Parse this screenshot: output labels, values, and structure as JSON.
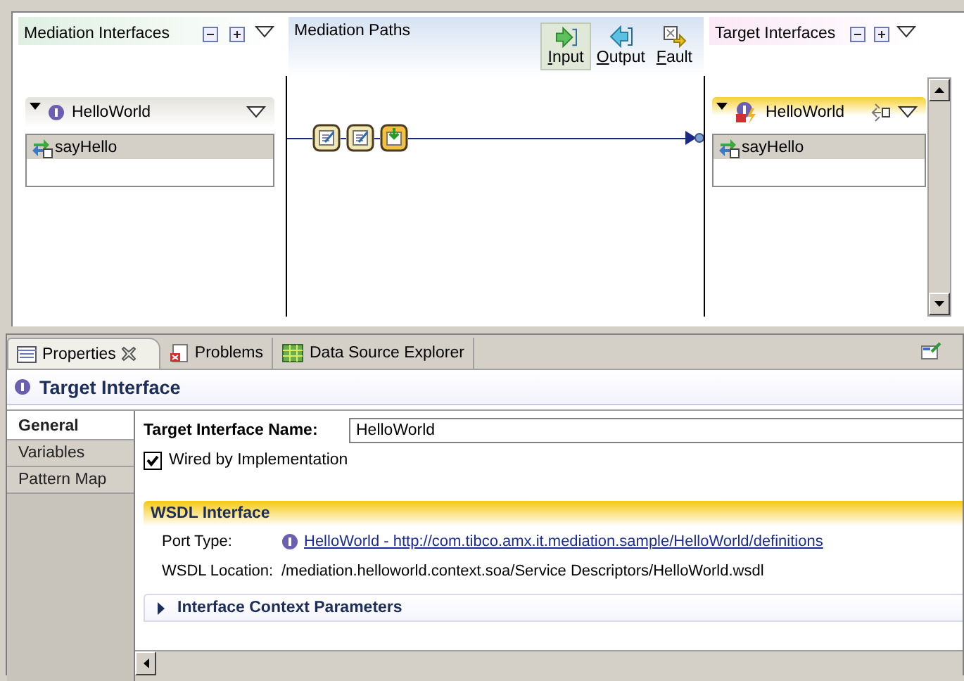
{
  "editor": {
    "mediation_interfaces": {
      "title": "Mediation Interfaces",
      "interface": {
        "name": "HelloWorld",
        "expanded": true,
        "operations": [
          {
            "name": "sayHello",
            "selected": true
          }
        ]
      }
    },
    "mediation_paths": {
      "title": "Mediation Paths",
      "buttons": [
        {
          "label": "Input",
          "selected": true
        },
        {
          "label": "Output",
          "selected": false
        },
        {
          "label": "Fault",
          "selected": false
        }
      ]
    },
    "target_interfaces": {
      "title": "Target Interfaces",
      "interface": {
        "name": "HelloWorld",
        "expanded": true,
        "operations": [
          {
            "name": "sayHello",
            "selected": true
          }
        ]
      }
    }
  },
  "properties_panel": {
    "tabs": [
      {
        "label": "Properties",
        "selected": true,
        "closable": true
      },
      {
        "label": "Problems",
        "selected": false,
        "closable": false
      },
      {
        "label": "Data Source Explorer",
        "selected": false,
        "closable": false
      }
    ],
    "title": "Target Interface",
    "side_tabs": [
      {
        "label": "General",
        "selected": true
      },
      {
        "label": "Variables",
        "selected": false
      },
      {
        "label": "Pattern Map",
        "selected": false
      }
    ],
    "name_field": {
      "label": "Target Interface Name:",
      "value": "HelloWorld"
    },
    "wired_checkbox": {
      "label": "Wired by Implementation",
      "checked": true
    },
    "wsdl_section": {
      "title": "WSDL Interface",
      "expanded": true,
      "port_type_label": "Port Type:",
      "port_type_link": "HelloWorld - http://com.tibco.amx.it.mediation.sample/HelloWorld/definitions",
      "location_label": "WSDL Location:",
      "location": "/mediation.helloworld.context.soa/Service Descriptors/HelloWorld.wsdl"
    },
    "context_section": {
      "title": "Interface Context Parameters",
      "expanded": false
    }
  }
}
